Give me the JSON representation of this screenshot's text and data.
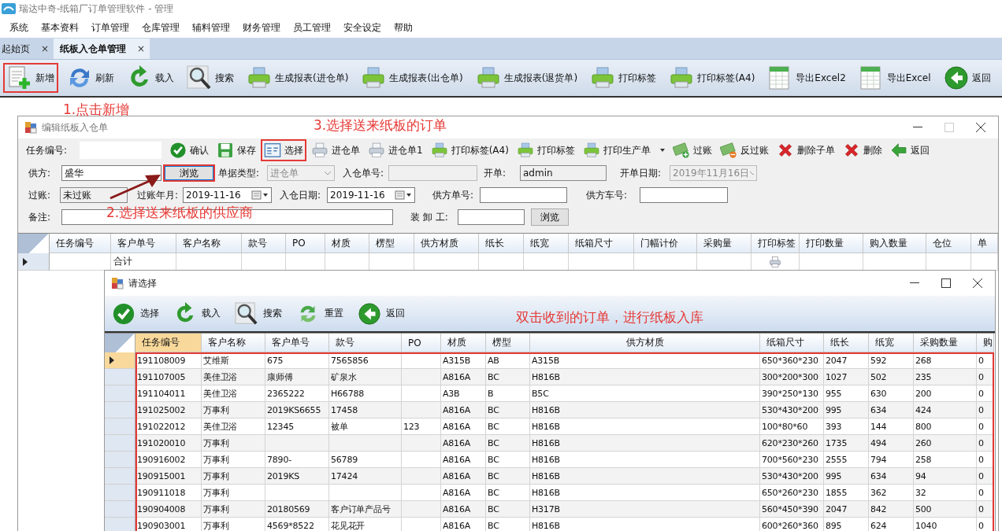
{
  "window": {
    "title": "瑞达中奇-纸箱厂订单管理软件 - 管理"
  },
  "menu": [
    "系统",
    "基本资料",
    "订单管理",
    "仓库管理",
    "辅料管理",
    "财务管理",
    "员工管理",
    "安全设定",
    "帮助"
  ],
  "tabs": [
    {
      "label": "起始页",
      "selected": false,
      "close": "×"
    },
    {
      "label": "纸板入仓单管理",
      "selected": true,
      "close": "×"
    }
  ],
  "toolbar": [
    {
      "label": "新增",
      "kind": "new",
      "highlighted": true
    },
    {
      "label": "刷新",
      "kind": "refresh",
      "highlighted": false
    },
    {
      "label": "载入",
      "kind": "reload",
      "highlighted": false
    },
    {
      "label": "搜索",
      "kind": "search",
      "highlighted": false
    },
    {
      "label": "生成报表(进仓单)",
      "kind": "printer",
      "highlighted": false
    },
    {
      "label": "生成报表(出仓单)",
      "kind": "printer",
      "highlighted": false
    },
    {
      "label": "生成报表(退货单)",
      "kind": "printer",
      "highlighted": false
    },
    {
      "label": "打印标签",
      "kind": "printer",
      "highlighted": false
    },
    {
      "label": "打印标签(A4)",
      "kind": "printer",
      "highlighted": false
    },
    {
      "label": "导出Excel2",
      "kind": "sheet",
      "highlighted": false
    },
    {
      "label": "导出Excel",
      "kind": "sheet",
      "highlighted": false
    },
    {
      "label": "返回",
      "kind": "back",
      "highlighted": false
    }
  ],
  "hints": {
    "add": "1.点击新增",
    "supplier": "2.选择送来纸板的供应商",
    "order": "3.选择送来纸板的订单",
    "double_click": "双击收到的订单，进行纸板入库"
  },
  "edit_dialog": {
    "title": "编辑纸板入仓单",
    "task_label": "任务编号:",
    "toolbar": [
      {
        "label": "确认",
        "kind": "check",
        "highlighted": false,
        "dropdown": false
      },
      {
        "label": "保存",
        "kind": "save",
        "highlighted": false,
        "dropdown": false
      },
      {
        "label": "选择",
        "kind": "select",
        "highlighted": true,
        "dropdown": false
      },
      {
        "label": "进仓单",
        "kind": "printer-grey",
        "highlighted": false,
        "dropdown": false
      },
      {
        "label": "进仓单1",
        "kind": "printer-grey",
        "highlighted": false,
        "dropdown": false
      },
      {
        "label": "打印标签(A4)",
        "kind": "printer",
        "highlighted": false,
        "dropdown": false
      },
      {
        "label": "打印标签",
        "kind": "printer",
        "highlighted": false,
        "dropdown": false
      },
      {
        "label": "打印生产单",
        "kind": "printer",
        "highlighted": false,
        "dropdown": true
      },
      {
        "label": "过账",
        "kind": "money-plus",
        "highlighted": false,
        "dropdown": false
      },
      {
        "label": "反过账",
        "kind": "money-minus",
        "highlighted": false,
        "dropdown": false
      },
      {
        "label": "删除子单",
        "kind": "delete",
        "highlighted": false,
        "dropdown": false
      },
      {
        "label": "删除",
        "kind": "delete",
        "highlighted": false,
        "dropdown": false
      },
      {
        "label": "返回",
        "kind": "arrow-left",
        "highlighted": false,
        "dropdown": false
      }
    ],
    "form": [
      [
        {
          "label": "供方:",
          "kind": "text",
          "value": "盛华",
          "disabled": false
        },
        {
          "kind": "button",
          "label": "浏览",
          "highlighted": true,
          "disabled": false
        },
        {
          "label": "单据类型:",
          "kind": "combo",
          "value": "进仓单",
          "disabled": true
        },
        {
          "label": "入仓单号:",
          "kind": "text",
          "disabled": true
        },
        {
          "label": "开单:",
          "kind": "text",
          "value": "admin",
          "disabled": true
        },
        {
          "label": "开单日期:",
          "kind": "combo",
          "value": "2019年11月16日",
          "disabled": true
        }
      ],
      [
        {
          "label": "过账:",
          "kind": "text",
          "value": "未过账",
          "disabled": true
        },
        {
          "label": "过账年月:",
          "kind": "date",
          "value": "2019-11-16",
          "disabled": false
        },
        {
          "label": "入仓日期:",
          "kind": "date",
          "value": "2019-11-16",
          "disabled": false
        },
        {
          "label": "供方单号:",
          "kind": "text",
          "disabled": false
        },
        {
          "label": "供方车号:",
          "kind": "text",
          "disabled": false
        }
      ],
      [
        {
          "label": "备注:",
          "kind": "text",
          "disabled": false
        },
        {
          "label": "装 卸 工:",
          "kind": "text",
          "disabled": false
        },
        {
          "kind": "button",
          "label": "浏览",
          "highlighted": false,
          "disabled": false
        }
      ]
    ],
    "table": {
      "columns": [
        {
          "label": "任务编号",
          "kind": "text"
        },
        {
          "label": "客户单号",
          "kind": "text"
        },
        {
          "label": "客户名称",
          "kind": "text"
        },
        {
          "label": "款号",
          "kind": "text"
        },
        {
          "label": "PO",
          "kind": "text"
        },
        {
          "label": "材质",
          "kind": "text"
        },
        {
          "label": "楞型",
          "kind": "text"
        },
        {
          "label": "供方材质",
          "kind": "text"
        },
        {
          "label": "纸长",
          "kind": "text"
        },
        {
          "label": "纸宽",
          "kind": "text"
        },
        {
          "label": "纸箱尺寸",
          "kind": "text"
        },
        {
          "label": "门幅计价",
          "kind": "text"
        },
        {
          "label": "采购量",
          "kind": "text"
        },
        {
          "label": "打印标签",
          "kind": "print"
        },
        {
          "label": "打印数量",
          "kind": "text"
        },
        {
          "label": "购入数量",
          "kind": "text"
        },
        {
          "label": "仓位",
          "kind": "text"
        },
        {
          "label": "单",
          "kind": "text"
        }
      ],
      "rows": [
        {
          "current": true,
          "cells": [
            "",
            "合计",
            "",
            "",
            "",
            "",
            "",
            "",
            "",
            "",
            "",
            "",
            "",
            "",
            "",
            "",
            "",
            ""
          ]
        }
      ]
    }
  },
  "select_dialog": {
    "title": "请选择",
    "toolbar": [
      {
        "label": "选择",
        "kind": "check"
      },
      {
        "label": "载入",
        "kind": "reload"
      },
      {
        "label": "搜索",
        "kind": "search"
      },
      {
        "label": "重置",
        "kind": "reset"
      },
      {
        "label": "返回",
        "kind": "back"
      }
    ],
    "table": {
      "rows_highlighted": true,
      "columns": [
        {
          "label": "任务编号",
          "selected": true
        },
        {
          "label": "客户名称",
          "selected": false
        },
        {
          "label": "客户单号",
          "selected": false
        },
        {
          "label": "款号",
          "selected": false
        },
        {
          "label": "PO",
          "selected": false
        },
        {
          "label": "材质",
          "selected": false
        },
        {
          "label": "楞型",
          "selected": false
        },
        {
          "label": "供方材质",
          "selected": false
        },
        {
          "label": "纸箱尺寸",
          "selected": false
        },
        {
          "label": "纸长",
          "selected": false
        },
        {
          "label": "纸宽",
          "selected": false
        },
        {
          "label": "采购数量",
          "selected": false
        },
        {
          "label": "购",
          "selected": false
        }
      ],
      "rows": [
        {
          "current": true,
          "cells": [
            "191108009",
            "艾维斯",
            "675",
            "7565856",
            "",
            "A315B",
            "AB",
            "A315B",
            "650*360*230",
            "2047",
            "592",
            "268",
            "0"
          ]
        },
        {
          "current": false,
          "cells": [
            "191107005",
            "美佳卫浴",
            "康师傅",
            "矿泉水",
            "",
            "A816A",
            "BC",
            "H816B",
            "300*200*300",
            "1027",
            "502",
            "235",
            "0"
          ]
        },
        {
          "current": false,
          "cells": [
            "191104011",
            "美佳卫浴",
            "2365222",
            "H66788",
            "",
            "A3B",
            "B",
            "B5C",
            "390*250*130",
            "955",
            "630",
            "200",
            "0"
          ]
        },
        {
          "current": false,
          "cells": [
            "191025002",
            "万事利",
            "2019KS6655",
            "17458",
            "",
            "A816A",
            "BC",
            "H816B",
            "530*430*200",
            "995",
            "634",
            "424",
            "0"
          ]
        },
        {
          "current": false,
          "cells": [
            "191022012",
            "美佳卫浴",
            "12345",
            "被单",
            "123",
            "A816A",
            "BC",
            "H816B",
            "100*80*60",
            "393",
            "144",
            "800",
            "0"
          ]
        },
        {
          "current": false,
          "cells": [
            "191020010",
            "万事利",
            "",
            "",
            "",
            "A816A",
            "BC",
            "H816B",
            "620*230*260",
            "1735",
            "494",
            "260",
            "0"
          ]
        },
        {
          "current": false,
          "cells": [
            "190916002",
            "万事利",
            "7890-",
            "56789",
            "",
            "A816A",
            "BC",
            "H816B",
            "700*560*230",
            "2555",
            "794",
            "258",
            "0"
          ]
        },
        {
          "current": false,
          "cells": [
            "190915001",
            "万事利",
            "2019KS",
            "17424",
            "",
            "A816A",
            "BC",
            "H816B",
            "530*430*200",
            "995",
            "634",
            "94",
            "0"
          ]
        },
        {
          "current": false,
          "cells": [
            "190911018",
            "万事利",
            "",
            "",
            "",
            "A816A",
            "BC",
            "H816B",
            "650*260*230",
            "1855",
            "362",
            "32",
            "0"
          ]
        },
        {
          "current": false,
          "cells": [
            "190904008",
            "万事利",
            "20180569",
            "客户订单产品号",
            "",
            "A816A",
            "BC",
            "H317B",
            "560*450*390",
            "2047",
            "842",
            "500",
            "0"
          ]
        },
        {
          "current": false,
          "cells": [
            "190903001",
            "万事利",
            "4569*8522",
            "花见花开",
            "",
            "A816A",
            "BC",
            "H816B",
            "600*260*360",
            "895",
            "624",
            "1040",
            "0"
          ]
        }
      ]
    }
  }
}
